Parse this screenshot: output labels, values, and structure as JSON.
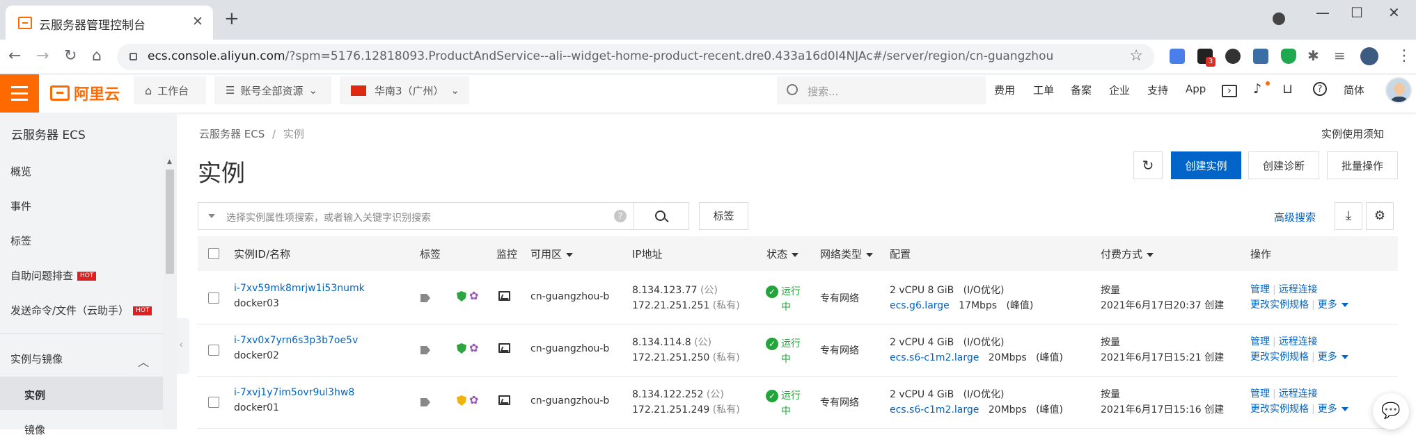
{
  "browser": {
    "tab_title": "云服务器管理控制台",
    "url_domain": "ecs.console.aliyun.com",
    "url_rest": "/?spm=5176.12818093.ProductAndService--ali--widget-home-product-recent.dre0.433a16d0I4NJAc#/server/region/cn-guangzhou",
    "ext_badge": "3"
  },
  "topnav": {
    "logo_text": "阿里云",
    "workbench": "工作台",
    "resources": "账号全部资源",
    "region": "华南3（广州）",
    "search_placeholder": "搜索...",
    "links": [
      "费用",
      "工单",
      "备案",
      "企业",
      "支持",
      "App"
    ],
    "lang": "简体"
  },
  "sidebar": {
    "title": "云服务器 ECS",
    "items": [
      "概览",
      "事件",
      "标签",
      "自助问题排查",
      "发送命令/文件（云助手）"
    ],
    "hot_label": "HOT",
    "group": "实例与镜像",
    "selected": "实例",
    "next": "镜像"
  },
  "page": {
    "breadcrumb_root": "云服务器 ECS",
    "breadcrumb_sep": "/",
    "breadcrumb_current": "实例",
    "title": "实例",
    "notice": "实例使用须知",
    "create_btn": "创建实例",
    "diagnose_btn": "创建诊断",
    "batch_btn": "批量操作",
    "filter_placeholder": "选择实例属性项搜索，或者输入关键字识别搜索",
    "tag_btn": "标签",
    "advanced_search": "高级搜索"
  },
  "table": {
    "headers": {
      "id": "实例ID/名称",
      "tag": "标签",
      "monitor": "监控",
      "zone": "可用区",
      "ip": "IP地址",
      "status": "状态",
      "network": "网络类型",
      "config": "配置",
      "billing": "付费方式",
      "actions": "操作"
    },
    "rows": [
      {
        "id": "i-7xv59mk8mrjw1i53numk",
        "name": "docker03",
        "zone": "cn-guangzhou-b",
        "ip_public": "8.134.123.77",
        "pub_tag": "(公)",
        "ip_private": "172.21.251.251",
        "priv_tag": "(私有)",
        "status": "运行中",
        "network": "专有网络",
        "config": "2 vCPU 8 GiB",
        "io": "(I/O优化)",
        "spec": "ecs.g6.large",
        "bandwidth": "17Mbps",
        "peak": "(峰值)",
        "billing": "按量",
        "created": "2021年6月17日20:37 创建",
        "manage": "管理",
        "remote": "远程连接",
        "resize": "更改实例规格",
        "more": "更多"
      },
      {
        "id": "i-7xv0x7yrn6s3p3b7oe5v",
        "name": "docker02",
        "zone": "cn-guangzhou-b",
        "ip_public": "8.134.114.8",
        "pub_tag": "(公)",
        "ip_private": "172.21.251.250",
        "priv_tag": "(私有)",
        "status": "运行中",
        "network": "专有网络",
        "config": "2 vCPU 4 GiB",
        "io": "(I/O优化)",
        "spec": "ecs.s6-c1m2.large",
        "bandwidth": "20Mbps",
        "peak": "(峰值)",
        "billing": "按量",
        "created": "2021年6月17日15:21 创建",
        "manage": "管理",
        "remote": "远程连接",
        "resize": "更改实例规格",
        "more": "更多"
      },
      {
        "id": "i-7xvj1y7im5ovr9ul3hw8",
        "name": "docker01",
        "zone": "cn-guangzhou-b",
        "ip_public": "8.134.122.252",
        "pub_tag": "(公)",
        "ip_private": "172.21.251.249",
        "priv_tag": "(私有)",
        "status": "运行中",
        "network": "专有网络",
        "config": "2 vCPU 4 GiB",
        "io": "(I/O优化)",
        "spec": "ecs.s6-c1m2.large",
        "bandwidth": "20Mbps",
        "peak": "(峰值)",
        "billing": "按量",
        "created": "2021年6月17日15:16 创建",
        "manage": "管理",
        "remote": "远程连接",
        "resize": "更改实例规格",
        "more": "更多"
      }
    ]
  },
  "colors": {
    "brand": "#ff6a00",
    "primary": "#0064c8",
    "running": "#22a53a"
  }
}
